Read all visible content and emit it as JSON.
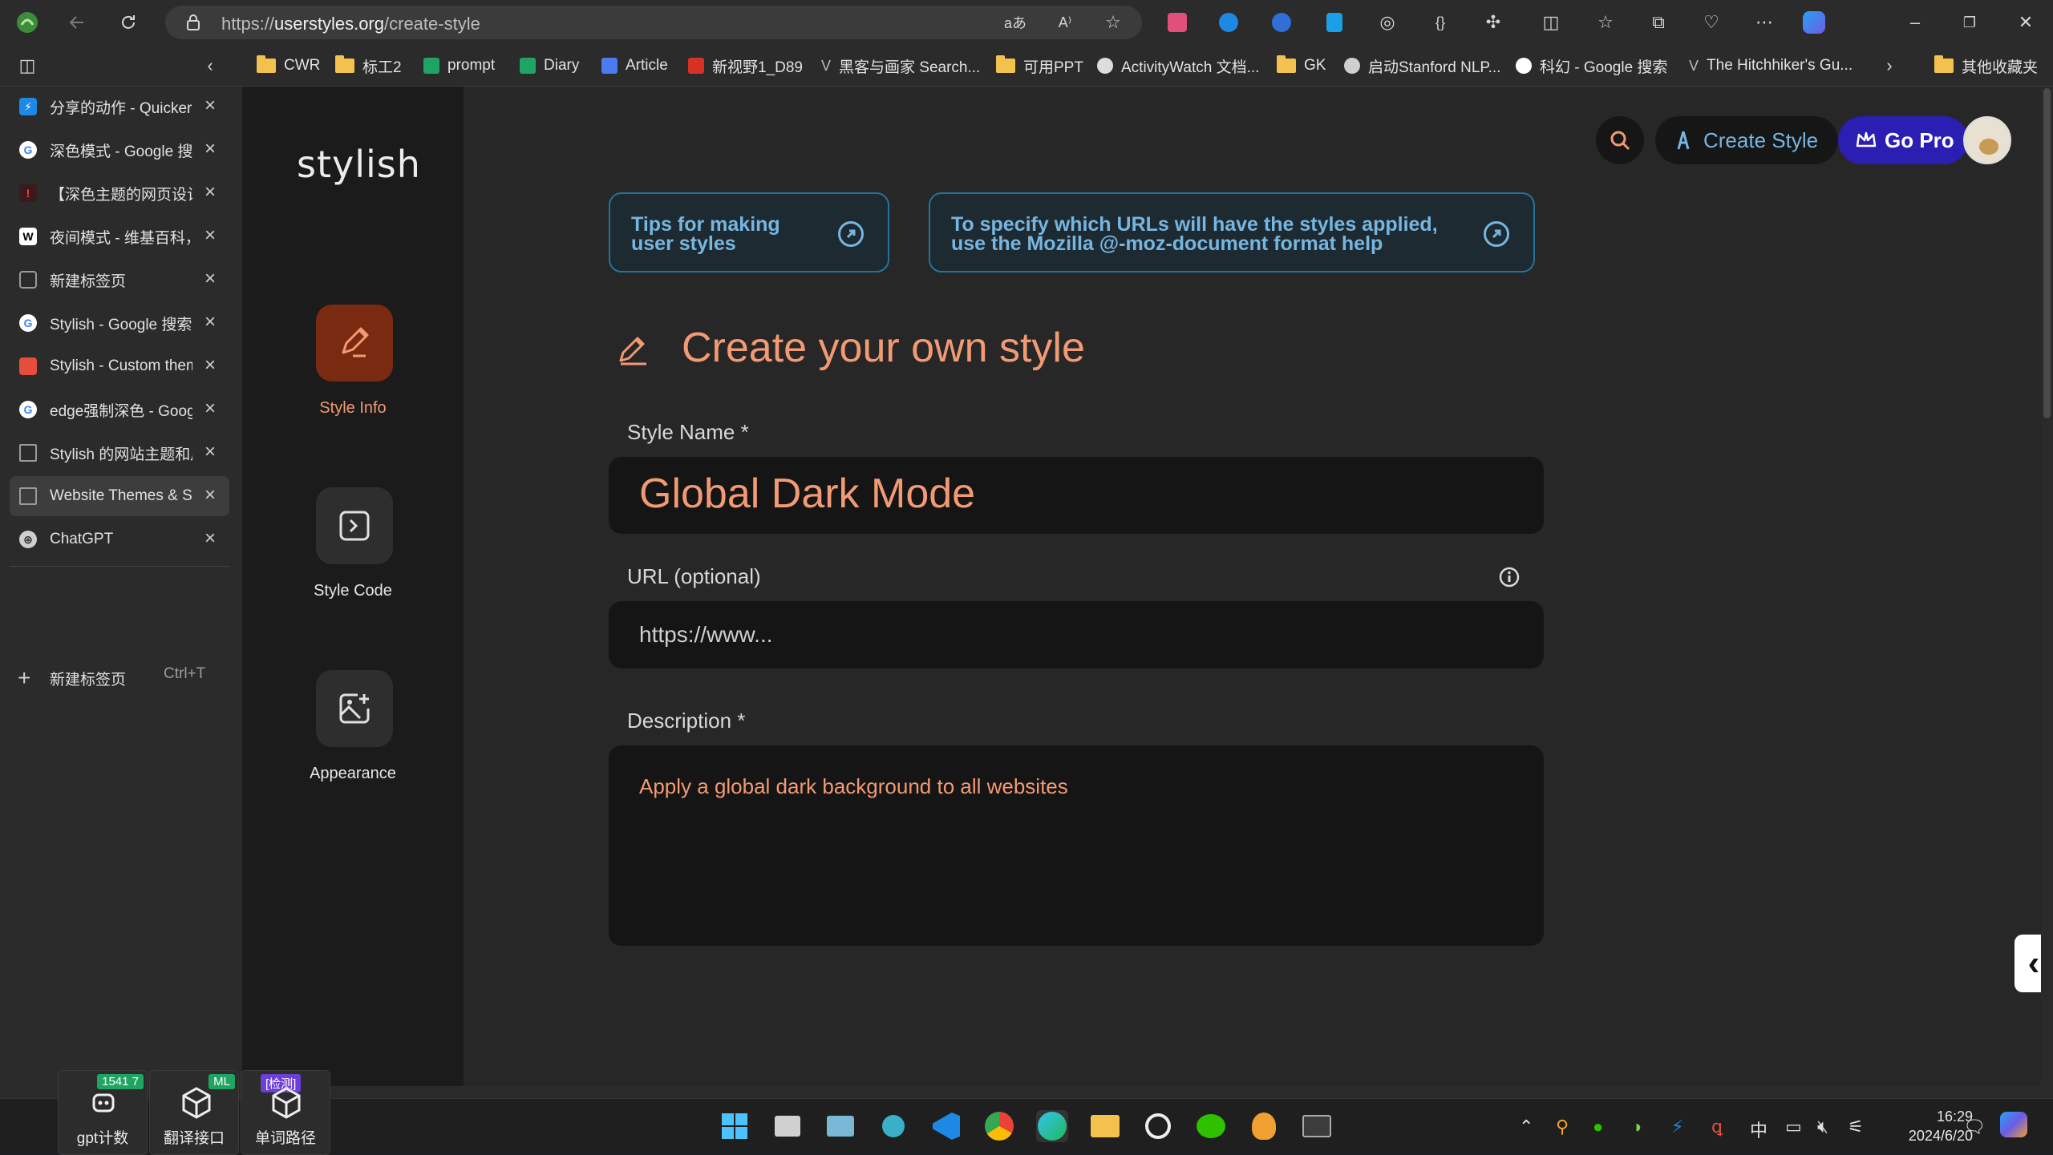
{
  "browser": {
    "url_prefix": "https://",
    "url_domain": "userstyles.org",
    "url_path": "/create-style",
    "bookmarks": [
      {
        "label": "CWR",
        "icon": "folder-icon"
      },
      {
        "label": "标工2",
        "icon": "folder-icon"
      },
      {
        "label": "prompt",
        "icon": "sheet-icon"
      },
      {
        "label": "Diary",
        "icon": "sheet-icon"
      },
      {
        "label": "Article",
        "icon": "doc-icon"
      },
      {
        "label": "新视野1_D89",
        "icon": "pdf-icon"
      },
      {
        "label": "黑客与画家 Search...",
        "icon": "v-icon"
      },
      {
        "label": "可用PPT",
        "icon": "folder-icon"
      },
      {
        "label": "ActivityWatch 文档...",
        "icon": "aw-icon"
      },
      {
        "label": "GK",
        "icon": "folder-icon"
      },
      {
        "label": "启动Stanford NLP...",
        "icon": "chatgpt-icon"
      },
      {
        "label": "科幻 - Google 搜索",
        "icon": "google-icon"
      },
      {
        "label": "The Hitchhiker's Gu...",
        "icon": "v-icon"
      },
      {
        "label": "其他收藏夹",
        "icon": "folder-icon"
      }
    ]
  },
  "tabs": [
    {
      "title": "分享的动作 - Quicker",
      "favicon": "quicker",
      "color": "#1e88e5"
    },
    {
      "title": "深色模式 - Google 搜索",
      "favicon": "google",
      "color": "#ffffff"
    },
    {
      "title": "【深色主题的网页设计",
      "favicon": "bilibili",
      "color": "#c0392b"
    },
    {
      "title": "夜间模式 - 维基百科，",
      "favicon": "wiki",
      "color": "#ffffff"
    },
    {
      "title": "新建标签页",
      "favicon": "newtab",
      "color": "#9a9a9a"
    },
    {
      "title": "Stylish - Google 搜索",
      "favicon": "google",
      "color": "#ffffff"
    },
    {
      "title": "Stylish - Custom theme",
      "favicon": "stylish",
      "color": "#e74c3c"
    },
    {
      "title": "edge强制深色 - Google",
      "favicon": "google",
      "color": "#ffffff"
    },
    {
      "title": "Stylish 的网站主题和皮",
      "favicon": "page",
      "color": "#9a9a9a"
    },
    {
      "title": "Website Themes & Ski",
      "favicon": "page",
      "color": "#9a9a9a"
    },
    {
      "title": "ChatGPT",
      "favicon": "chatgpt",
      "color": "#cfcfcf"
    }
  ],
  "new_tab": {
    "label": "新建标签页",
    "shortcut": "Ctrl+T"
  },
  "stylish": {
    "logo": "stylish",
    "steps": [
      {
        "label": "Style Info",
        "icon": "pencil-icon",
        "active": true
      },
      {
        "label": "Style Code",
        "icon": "code-icon",
        "active": false
      },
      {
        "label": "Appearance",
        "icon": "image-add-icon",
        "active": false
      }
    ],
    "header": {
      "create_style": "Create Style",
      "go_pro": "Go Pro"
    },
    "tips": [
      {
        "line1": "Tips for making",
        "line2": "user styles"
      },
      {
        "line1": "To specify which URLs will have the styles applied,",
        "line2": "use the Mozilla @-moz-document format help"
      }
    ],
    "title": "Create your own style",
    "form": {
      "name_label": "Style Name *",
      "name_value": "Global Dark Mode",
      "url_label": "URL (optional)",
      "url_placeholder": "https://www...",
      "description_label": "Description *",
      "description_value": "Apply a global dark background to all websites"
    }
  },
  "taskbar": {
    "widgets": [
      {
        "name": "gpt计数",
        "badge": "1541 7"
      },
      {
        "name": "翻译接口",
        "badge": "ML"
      },
      {
        "name": "单词路径",
        "badge": "[检测]"
      }
    ],
    "ime": "中",
    "time": "16:29",
    "date": "2024/6/20"
  },
  "colors": {
    "accent": "#f29a73",
    "active_step": "#7a2a10",
    "tip_border": "#26729a",
    "go_pro": "#2b1fb3"
  }
}
